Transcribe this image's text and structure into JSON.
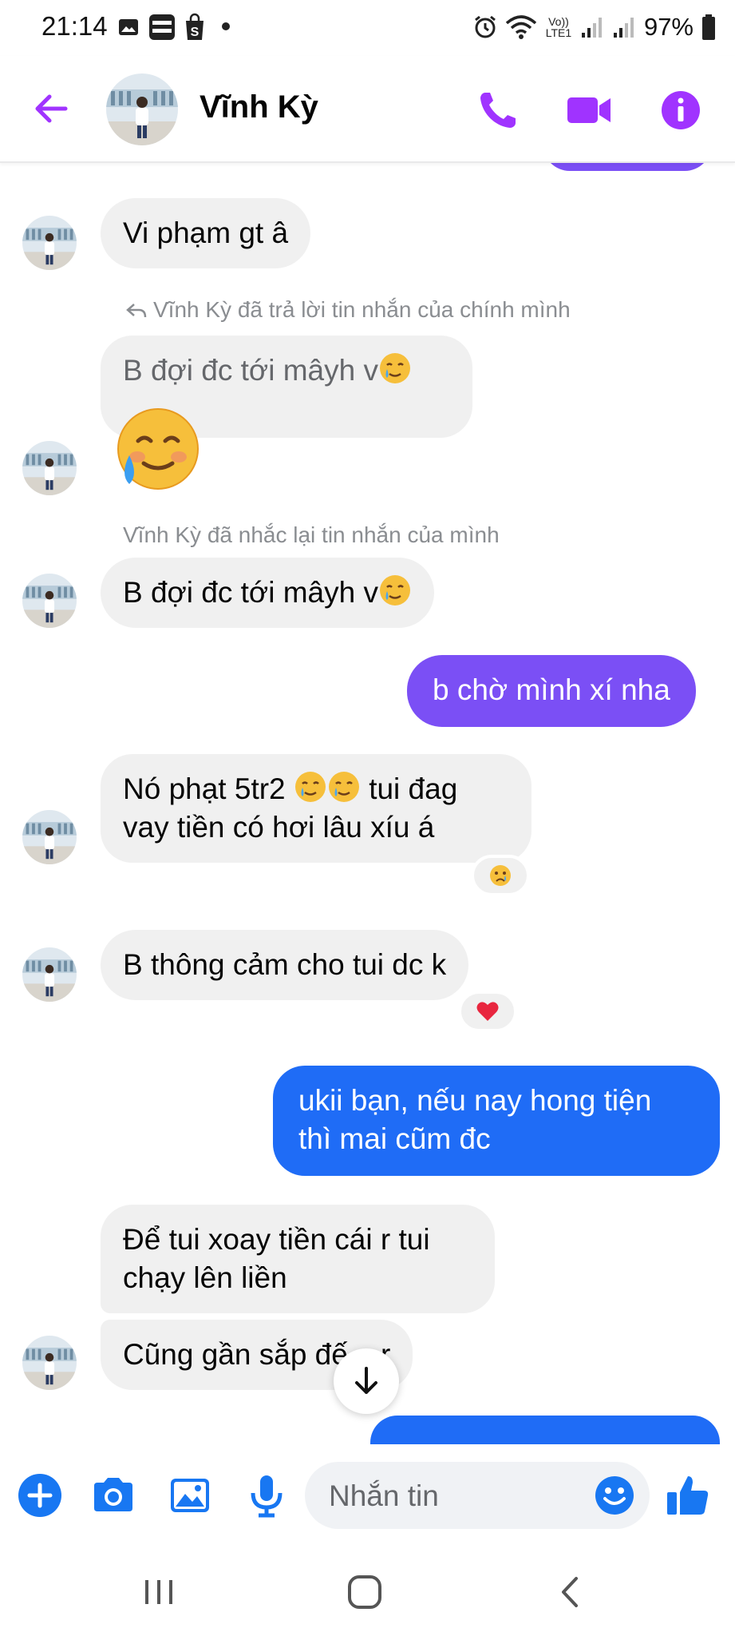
{
  "status_bar": {
    "time": "21:14",
    "battery": "97%",
    "network_label": "Vo)) LTE1"
  },
  "header": {
    "contact_name": "Vĩnh Kỳ",
    "accent_color": "#a033ff"
  },
  "messages": {
    "m1": "Vi phạm gt â",
    "reply_meta": "Vĩnh Kỳ đã trả lời tin nhắn của chính mình",
    "m2": "B đợi đc tới mâyh v",
    "repeat_meta": "Vĩnh Kỳ đã nhắc lại tin nhắn của mình",
    "m3": "B đợi đc tới mâyh v",
    "out1": "b chờ mình xí nha",
    "m4_line1": "Nó phạt 5tr2",
    "m4_line1b": "tui đag",
    "m4_line2": "vay tiền có hơi lâu xíu á",
    "m5": "B thông cảm cho tui dc k",
    "out2_line1": "ukii bạn, nếu nay hong tiện",
    "out2_line2": "thì mai cũm đc",
    "m6_line1": "Để tui xoay tiền cái r tui",
    "m6_line2": "chạy lên liền",
    "m7": "Cũng gần sắp đế... r"
  },
  "composer": {
    "placeholder": "Nhắn tin"
  },
  "colors": {
    "purple_bubble": "#7b4ff5",
    "blue_bubble": "#1f6cf6",
    "incoming_bubble": "#f0f0f0",
    "composer_icon": "#1877f2"
  },
  "icons": [
    "back-arrow-icon",
    "phone-icon",
    "video-icon",
    "info-icon",
    "plus-icon",
    "camera-icon",
    "gallery-icon",
    "mic-icon",
    "emoji-icon",
    "like-icon",
    "scroll-down-icon"
  ]
}
